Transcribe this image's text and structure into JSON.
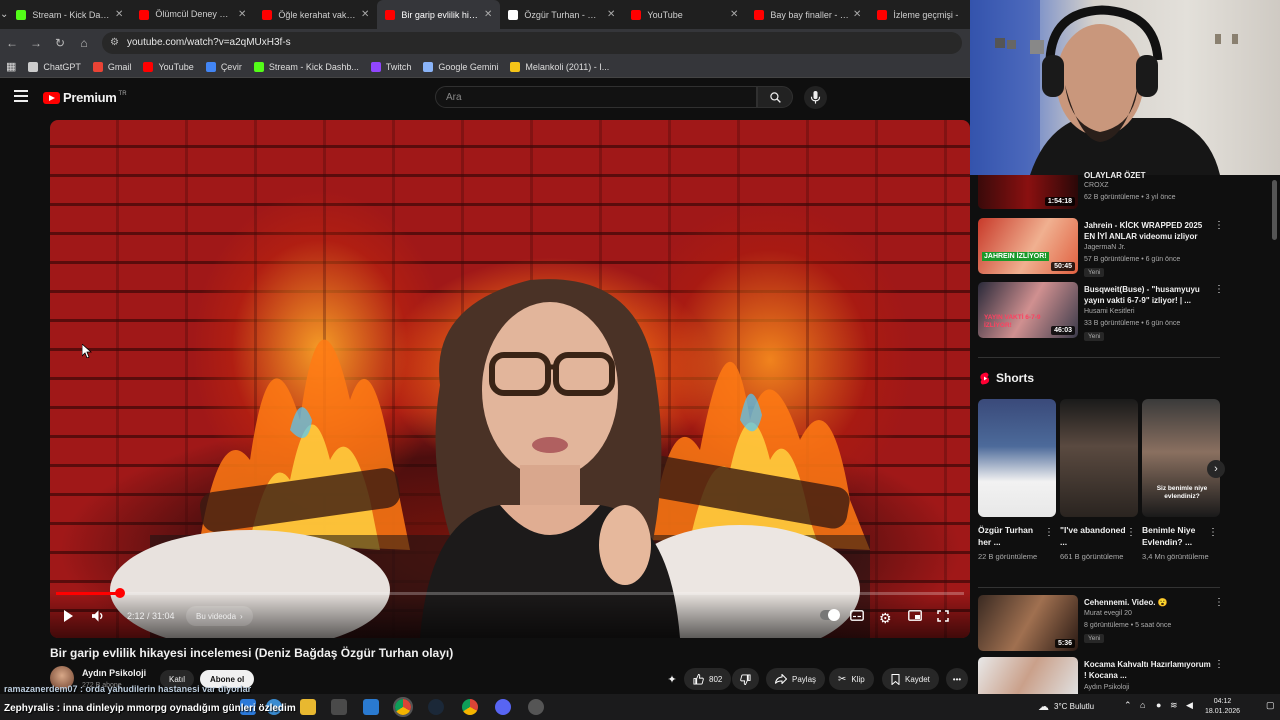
{
  "browser": {
    "tabs": [
      {
        "title": "Stream - Kick Dashbo",
        "color": "#53fc18"
      },
      {
        "title": "Ölümcül Deney ★1★",
        "color": "#ff0000"
      },
      {
        "title": "Öğle kerahat vakti kaç",
        "color": "#ff0000"
      },
      {
        "title": "Bir garip evlilik hikaye",
        "color": "#ff0000",
        "active": true
      },
      {
        "title": "Özgür Turhan - Goog",
        "color": "#ffffff"
      },
      {
        "title": "YouTube",
        "color": "#ff0000"
      },
      {
        "title": "Bay bay finaller - You",
        "color": "#ff0000"
      },
      {
        "title": "İzleme geçmişi -",
        "color": "#ff0000"
      }
    ],
    "url": "youtube.com/watch?v=a2qMUxH3f-s",
    "bookmarks": [
      {
        "label": "ChatGPT",
        "color": "#cccccc"
      },
      {
        "label": "Gmail",
        "color": "#ea4335"
      },
      {
        "label": "YouTube",
        "color": "#ff0000"
      },
      {
        "label": "Çevir",
        "color": "#4285f4"
      },
      {
        "label": "Stream - Kick Dashb...",
        "color": "#53fc18"
      },
      {
        "label": "Twitch",
        "color": "#9146ff"
      },
      {
        "label": "Google Gemini",
        "color": "#8ab4f8"
      },
      {
        "label": "Melankoli (2011) - I...",
        "color": "#f5c518"
      }
    ]
  },
  "youtube": {
    "logo_text": "Premium",
    "logo_region": "TR",
    "search_placeholder": "Ara"
  },
  "player": {
    "current_time": "2:12",
    "duration": "31:04",
    "time_text": "2:12 / 31:04",
    "progress_fraction": 0.071,
    "chapter_button": "Bu videoda"
  },
  "video": {
    "title": "Bir garip evlilik hikayesi incelemesi (Deniz Bağdaş Özgür Turhan olayı)",
    "channel": "Aydın Psikoloji",
    "subscribers": "272 B abone",
    "join_label": "Katıl",
    "subscribe_label": "Abone ol",
    "likes": "802",
    "share_label": "Paylaş",
    "clip_label": "Klip",
    "save_label": "Kaydet"
  },
  "chat": {
    "line1": "ramazanerdem07 : orda yahudilerin hastanesi var diyorlar",
    "line2": "Zephyralis : inna dinleyip mmorpg oynadığım günleri özledim"
  },
  "sidebar": {
    "related": [
      {
        "title": "OLAYLAR ÖZET",
        "channel": "CROXZ",
        "meta": "62 B görüntüleme • 3 yıl önce",
        "duration": "1:54:18",
        "new": ""
      },
      {
        "title": "Jahrein - KİCK WRAPPED 2025 EN İYİ ANLAR videomu izliyor",
        "channel": "JagermaN Jr.",
        "meta": "57 B görüntüleme • 6 gün önce",
        "duration": "50:45",
        "new": "Yeni"
      },
      {
        "title": "Busqweit(Buse) - \"husamyuyu yayın vakti 6-7-9\" izliyor! | ...",
        "channel": "Husami Kesitleri",
        "meta": "33 B görüntüleme • 6 gün önce",
        "duration": "46:03",
        "new": "Yeni"
      }
    ],
    "shorts_heading": "Shorts",
    "shorts": [
      {
        "title": "Özgür Turhan her ...",
        "views": "22 B görüntüleme"
      },
      {
        "title": "\"I've abandoned ...",
        "views": "661 B görüntüleme"
      },
      {
        "title": "Benimle Niye Evlendin? ...",
        "views": "3,4 Mn görüntüleme"
      }
    ],
    "related2": [
      {
        "title": "Cehennemi. Video. 😮",
        "channel": "Murat evegil 20",
        "meta": "8 görüntüleme • 5 saat önce",
        "duration": "5:36",
        "new": "Yeni"
      },
      {
        "title": "Kocama Kahvaltı Hazırlamıyorum ! Kocana ...",
        "channel": "Aydın Psikoloji",
        "meta": "",
        "duration": "",
        "new": ""
      }
    ],
    "thumb_overlay": {
      "jahrein": "JAHREIN İZLİYOR!",
      "busqweit": "YAYIN VAKTİ 6-7-9 İZLİYOR!",
      "short1": "",
      "short3": "Siz benimle niye evlendiniz?"
    }
  },
  "taskbar": {
    "weather": "3°C  Bulutlu",
    "time": "04:12",
    "date": "18.01.2026"
  }
}
